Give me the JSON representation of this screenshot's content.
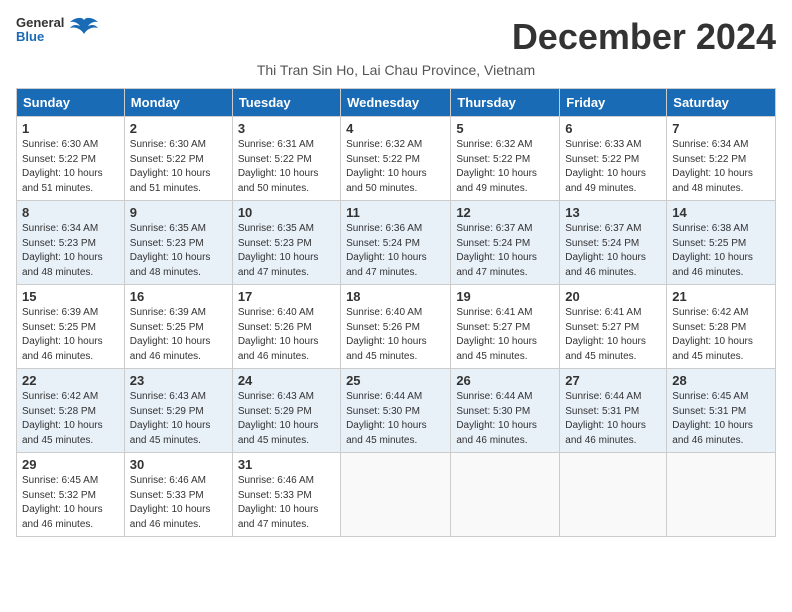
{
  "header": {
    "logo_line1": "General",
    "logo_line2": "Blue",
    "month_title": "December 2024",
    "subtitle": "Thi Tran Sin Ho, Lai Chau Province, Vietnam"
  },
  "weekdays": [
    "Sunday",
    "Monday",
    "Tuesday",
    "Wednesday",
    "Thursday",
    "Friday",
    "Saturday"
  ],
  "weeks": [
    [
      {
        "day": "1",
        "sunrise": "6:30 AM",
        "sunset": "5:22 PM",
        "daylight": "10 hours and 51 minutes."
      },
      {
        "day": "2",
        "sunrise": "6:30 AM",
        "sunset": "5:22 PM",
        "daylight": "10 hours and 51 minutes."
      },
      {
        "day": "3",
        "sunrise": "6:31 AM",
        "sunset": "5:22 PM",
        "daylight": "10 hours and 50 minutes."
      },
      {
        "day": "4",
        "sunrise": "6:32 AM",
        "sunset": "5:22 PM",
        "daylight": "10 hours and 50 minutes."
      },
      {
        "day": "5",
        "sunrise": "6:32 AM",
        "sunset": "5:22 PM",
        "daylight": "10 hours and 49 minutes."
      },
      {
        "day": "6",
        "sunrise": "6:33 AM",
        "sunset": "5:22 PM",
        "daylight": "10 hours and 49 minutes."
      },
      {
        "day": "7",
        "sunrise": "6:34 AM",
        "sunset": "5:22 PM",
        "daylight": "10 hours and 48 minutes."
      }
    ],
    [
      {
        "day": "8",
        "sunrise": "6:34 AM",
        "sunset": "5:23 PM",
        "daylight": "10 hours and 48 minutes."
      },
      {
        "day": "9",
        "sunrise": "6:35 AM",
        "sunset": "5:23 PM",
        "daylight": "10 hours and 48 minutes."
      },
      {
        "day": "10",
        "sunrise": "6:35 AM",
        "sunset": "5:23 PM",
        "daylight": "10 hours and 47 minutes."
      },
      {
        "day": "11",
        "sunrise": "6:36 AM",
        "sunset": "5:24 PM",
        "daylight": "10 hours and 47 minutes."
      },
      {
        "day": "12",
        "sunrise": "6:37 AM",
        "sunset": "5:24 PM",
        "daylight": "10 hours and 47 minutes."
      },
      {
        "day": "13",
        "sunrise": "6:37 AM",
        "sunset": "5:24 PM",
        "daylight": "10 hours and 46 minutes."
      },
      {
        "day": "14",
        "sunrise": "6:38 AM",
        "sunset": "5:25 PM",
        "daylight": "10 hours and 46 minutes."
      }
    ],
    [
      {
        "day": "15",
        "sunrise": "6:39 AM",
        "sunset": "5:25 PM",
        "daylight": "10 hours and 46 minutes."
      },
      {
        "day": "16",
        "sunrise": "6:39 AM",
        "sunset": "5:25 PM",
        "daylight": "10 hours and 46 minutes."
      },
      {
        "day": "17",
        "sunrise": "6:40 AM",
        "sunset": "5:26 PM",
        "daylight": "10 hours and 46 minutes."
      },
      {
        "day": "18",
        "sunrise": "6:40 AM",
        "sunset": "5:26 PM",
        "daylight": "10 hours and 45 minutes."
      },
      {
        "day": "19",
        "sunrise": "6:41 AM",
        "sunset": "5:27 PM",
        "daylight": "10 hours and 45 minutes."
      },
      {
        "day": "20",
        "sunrise": "6:41 AM",
        "sunset": "5:27 PM",
        "daylight": "10 hours and 45 minutes."
      },
      {
        "day": "21",
        "sunrise": "6:42 AM",
        "sunset": "5:28 PM",
        "daylight": "10 hours and 45 minutes."
      }
    ],
    [
      {
        "day": "22",
        "sunrise": "6:42 AM",
        "sunset": "5:28 PM",
        "daylight": "10 hours and 45 minutes."
      },
      {
        "day": "23",
        "sunrise": "6:43 AM",
        "sunset": "5:29 PM",
        "daylight": "10 hours and 45 minutes."
      },
      {
        "day": "24",
        "sunrise": "6:43 AM",
        "sunset": "5:29 PM",
        "daylight": "10 hours and 45 minutes."
      },
      {
        "day": "25",
        "sunrise": "6:44 AM",
        "sunset": "5:30 PM",
        "daylight": "10 hours and 45 minutes."
      },
      {
        "day": "26",
        "sunrise": "6:44 AM",
        "sunset": "5:30 PM",
        "daylight": "10 hours and 46 minutes."
      },
      {
        "day": "27",
        "sunrise": "6:44 AM",
        "sunset": "5:31 PM",
        "daylight": "10 hours and 46 minutes."
      },
      {
        "day": "28",
        "sunrise": "6:45 AM",
        "sunset": "5:31 PM",
        "daylight": "10 hours and 46 minutes."
      }
    ],
    [
      {
        "day": "29",
        "sunrise": "6:45 AM",
        "sunset": "5:32 PM",
        "daylight": "10 hours and 46 minutes."
      },
      {
        "day": "30",
        "sunrise": "6:46 AM",
        "sunset": "5:33 PM",
        "daylight": "10 hours and 46 minutes."
      },
      {
        "day": "31",
        "sunrise": "6:46 AM",
        "sunset": "5:33 PM",
        "daylight": "10 hours and 47 minutes."
      },
      null,
      null,
      null,
      null
    ]
  ]
}
